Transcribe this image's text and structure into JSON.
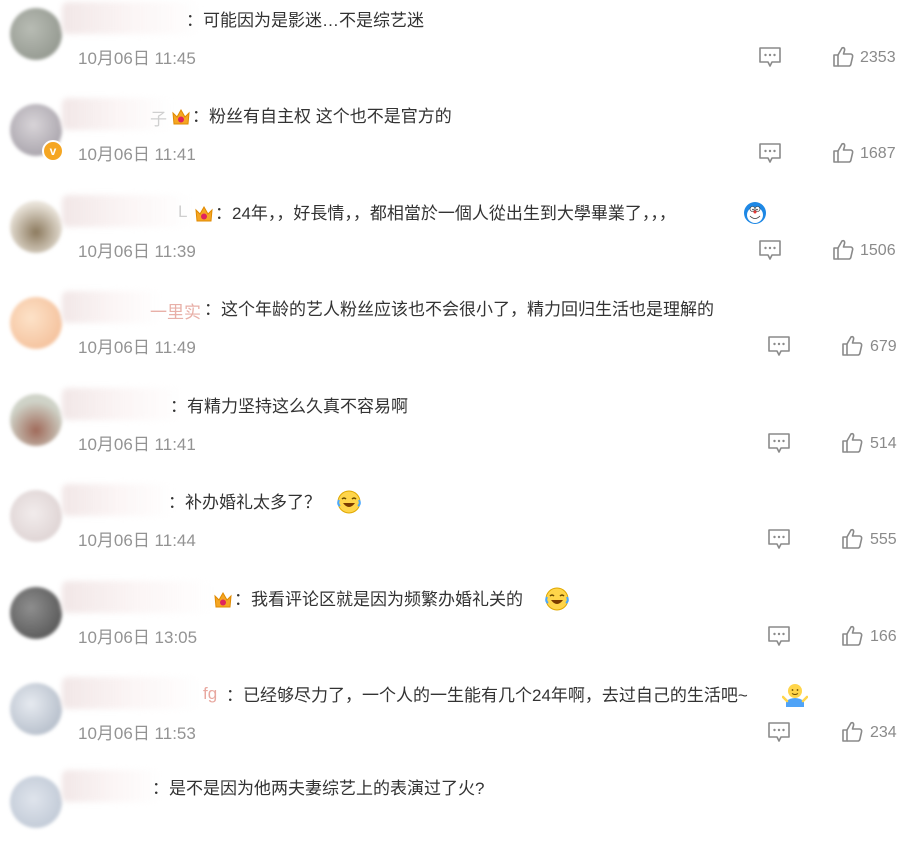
{
  "colors": {
    "text": "#333333",
    "time": "#939393",
    "icon": "#8a8a8a",
    "crown": "#f5a623",
    "crown_inner": "#e0245e"
  },
  "comments": [
    {
      "name_tail": "",
      "sep": "：",
      "text": "可能因为是影迷…不是综艺迷",
      "time": "10月06日 11:45",
      "likes": "2353",
      "icons": [
        "reply-icon",
        "like-icon"
      ]
    },
    {
      "name_tail": "子",
      "sep": "：",
      "text": "粉丝有自主权 这个也不是官方的",
      "time": "10月06日 11:41",
      "likes": "1687",
      "icons": [
        "crown-icon",
        "verified-badge-icon",
        "reply-icon",
        "like-icon"
      ]
    },
    {
      "name_tail": "L",
      "sep": "：",
      "text": "24年，，好長情，，都相當於一個人從出生到大學畢業了，，，",
      "time": "10月06日 11:39",
      "likes": "1506",
      "icons": [
        "crown-icon",
        "doraemon-emoji",
        "reply-icon",
        "like-icon"
      ]
    },
    {
      "name_tail": "一里实",
      "sep": "：",
      "text": "这个年龄的艺人粉丝应该也不会很小了，精力回归生活也是理解的",
      "time": "10月06日 11:49",
      "likes": "679",
      "icons": [
        "reply-icon",
        "like-icon"
      ]
    },
    {
      "name_tail": "",
      "sep": "：",
      "text": "有精力坚持这么久真不容易啊",
      "time": "10月06日 11:41",
      "likes": "514",
      "icons": [
        "reply-icon",
        "like-icon"
      ]
    },
    {
      "name_tail": "",
      "sep": "：",
      "text": "补办婚礼太多了？",
      "time": "10月06日 11:44",
      "likes": "555",
      "icons": [
        "laugh-cry-emoji",
        "reply-icon",
        "like-icon"
      ]
    },
    {
      "name_tail": "",
      "sep": "：",
      "text": "我看评论区就是因为频繁办婚礼关的",
      "time": "10月06日 13:05",
      "likes": "166",
      "icons": [
        "crown-icon",
        "laugh-cry-emoji",
        "reply-icon",
        "like-icon"
      ]
    },
    {
      "name_tail": "fg",
      "sep": "：",
      "text": "已经够尽力了，一个人的一生能有几个24年啊，去过自己的生活吧~",
      "time": "10月06日 11:53",
      "likes": "234",
      "icons": [
        "shrug-emoji",
        "reply-icon",
        "like-icon"
      ]
    },
    {
      "name_tail": "",
      "sep": "：",
      "text": "是不是因为他两夫妻综艺上的表演过了火?",
      "time": "",
      "likes": "",
      "icons": []
    }
  ]
}
